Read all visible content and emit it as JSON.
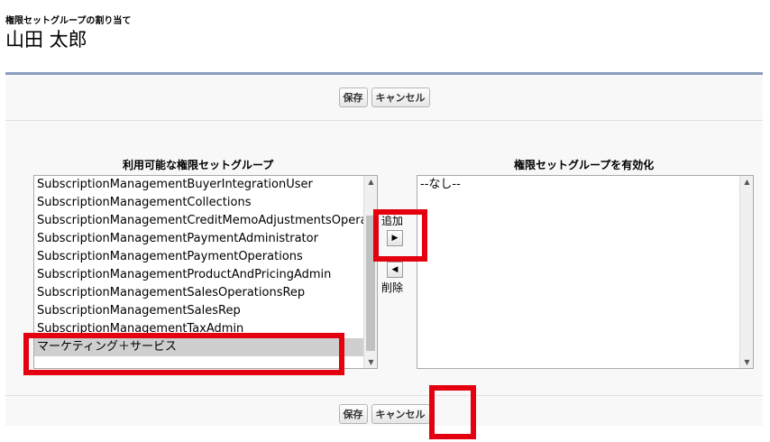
{
  "header": {
    "subtitle": "権限セットグループの割り当て",
    "title": "山田 太郎"
  },
  "buttons": {
    "save": "保存",
    "cancel": "キャンセル"
  },
  "available": {
    "label": "利用可能な権限セットグループ",
    "items": [
      "SubscriptionManagementBuyerIntegrationUser",
      "SubscriptionManagementCollections",
      "SubscriptionManagementCreditMemoAdjustmentsOperations",
      "SubscriptionManagementPaymentAdministrator",
      "SubscriptionManagementPaymentOperations",
      "SubscriptionManagementProductAndPricingAdmin",
      "SubscriptionManagementSalesOperationsRep",
      "SubscriptionManagementSalesRep",
      "SubscriptionManagementTaxAdmin",
      "マーケティング＋サービス"
    ],
    "selected_index": 9
  },
  "enabled": {
    "label": "権限セットグループを有効化",
    "items": [
      "--なし--"
    ]
  },
  "mover": {
    "add": "追加",
    "remove": "削除"
  },
  "colors": {
    "highlight": "#e4000f",
    "panel_border": "#8a9ebe"
  }
}
